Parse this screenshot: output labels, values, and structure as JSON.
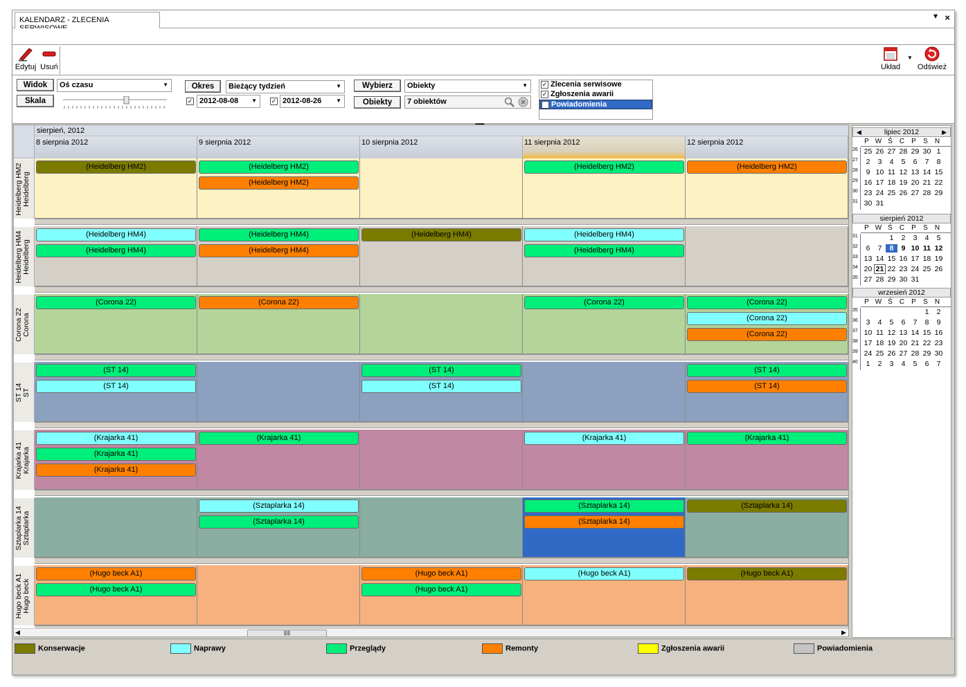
{
  "window": {
    "tab_title": "KALENDARZ - ZLECENIA SERWISOWE",
    "min_glyph": "▾",
    "close_glyph": "×"
  },
  "toolbar": {
    "edit": "Edytuj",
    "delete": "Usuń",
    "layout": "Układ",
    "refresh": "Odśwież"
  },
  "filters": {
    "view_label": "Widok",
    "view_value": "Oś czasu",
    "scale_label": "Skala",
    "period_label": "Okres",
    "period_value": "Bieżący tydzień",
    "date_from": "2012-08-08",
    "date_to": "2012-08-26",
    "select_label": "Wybierz",
    "select_value": "Obiekty",
    "objects_label": "Obiekty",
    "objects_value": "7 obiektów",
    "event_types": [
      {
        "label": "Zlecenia serwisowe",
        "checked": true,
        "selected": false
      },
      {
        "label": "Zgłoszenia awarii",
        "checked": true,
        "selected": false
      },
      {
        "label": "Powiadomienia",
        "checked": true,
        "selected": true
      }
    ]
  },
  "schedule": {
    "month_header": "sierpień, 2012",
    "days": [
      "8 sierpnia 2012",
      "9 sierpnia 2012",
      "10 sierpnia 2012",
      "11 sierpnia 2012",
      "12 sierpnia 2012"
    ],
    "today_index": 3,
    "resources": [
      {
        "line1": "Heidelberg HM2",
        "line2": "Heidelberg",
        "bg": "#fdf2c4",
        "events": [
          [
            [
              "Konserwacje",
              "(Heidelberg HM2)"
            ]
          ],
          [
            [
              "Przeglądy",
              "(Heidelberg HM2)"
            ],
            [
              "Remonty",
              "(Heidelberg HM2)"
            ]
          ],
          [],
          [
            [
              "Przeglądy",
              "(Heidelberg HM2)"
            ]
          ],
          [
            [
              "Remonty",
              "(Heidelberg HM2)"
            ]
          ]
        ]
      },
      {
        "line1": "Heidelberg HM4",
        "line2": "Heidelberg",
        "bg": "#d5d0c7",
        "events": [
          [
            [
              "Naprawy",
              "(Heidelberg HM4)"
            ],
            [
              "Przeglądy",
              "(Heidelberg HM4)"
            ]
          ],
          [
            [
              "Przeglądy",
              "(Heidelberg HM4)"
            ],
            [
              "Remonty",
              "(Heidelberg HM4)"
            ]
          ],
          [
            [
              "Konserwacje",
              "(Heidelberg HM4)"
            ]
          ],
          [
            [
              "Naprawy",
              "(Heidelberg HM4)"
            ],
            [
              "Przeglądy",
              "(Heidelberg HM4)"
            ]
          ],
          []
        ]
      },
      {
        "line1": "Corona 22",
        "line2": "Corona",
        "bg": "#b4d49a",
        "events": [
          [
            [
              "Przeglądy",
              "(Corona 22)"
            ]
          ],
          [
            [
              "Remonty",
              "(Corona 22)"
            ]
          ],
          [],
          [
            [
              "Przeglądy",
              "(Corona 22)"
            ]
          ],
          [
            [
              "Przeglądy",
              "(Corona 22)"
            ],
            [
              "Naprawy",
              "(Corona 22)"
            ],
            [
              "Remonty",
              "(Corona 22)"
            ]
          ]
        ]
      },
      {
        "line1": "ST 14",
        "line2": "ST",
        "bg": "#8ca0bf",
        "events": [
          [
            [
              "Przeglądy",
              "(ST 14)"
            ],
            [
              "Naprawy",
              "(ST 14)"
            ]
          ],
          [],
          [
            [
              "Przeglądy",
              "(ST 14)"
            ],
            [
              "Naprawy",
              "(ST 14)"
            ]
          ],
          [],
          [
            [
              "Przeglądy",
              "(ST 14)"
            ],
            [
              "Remonty",
              "(ST 14)"
            ]
          ]
        ]
      },
      {
        "line1": "Krajarka 41",
        "line2": "Krajarka",
        "bg": "#c088a2",
        "events": [
          [
            [
              "Naprawy",
              "(Krajarka 41)"
            ],
            [
              "Przeglądy",
              "(Krajarka 41)"
            ],
            [
              "Remonty",
              "(Krajarka 41)"
            ]
          ],
          [
            [
              "Przeglądy",
              "(Krajarka 41)"
            ]
          ],
          [],
          [
            [
              "Naprawy",
              "(Krajarka 41)"
            ]
          ],
          [
            [
              "Przeglądy",
              "(Krajarka 41)"
            ]
          ]
        ]
      },
      {
        "line1": "Sztaplarka 14",
        "line2": "Sztaplarka",
        "bg": "#8aaea2",
        "events": [
          [],
          [
            [
              "Naprawy",
              "(Sztaplarka 14)"
            ],
            [
              "Przeglądy",
              "(Sztaplarka 14)"
            ]
          ],
          [],
          [
            [
              "Przeglądy",
              "(Sztaplarka 14)"
            ],
            [
              "Remonty",
              "(Sztaplarka 14)"
            ]
          ],
          [
            [
              "Konserwacje",
              "(Sztaplarka 14)"
            ]
          ]
        ]
      },
      {
        "line1": "Hugo beck A1",
        "line2": "Hugo beck",
        "bg": "#f6b17f",
        "events": [
          [
            [
              "Remonty",
              "(Hugo beck A1)"
            ],
            [
              "Przeglądy",
              "(Hugo beck A1)"
            ]
          ],
          [],
          [
            [
              "Remonty",
              "(Hugo beck A1)"
            ],
            [
              "Przeglądy",
              "(Hugo beck A1)"
            ]
          ],
          [
            [
              "Naprawy",
              "(Hugo beck A1)"
            ]
          ],
          [
            [
              "Konserwacje",
              "(Hugo beck A1)"
            ]
          ]
        ]
      }
    ],
    "selected_cell": {
      "resource": 5,
      "day": 3,
      "color": "#316ac5"
    }
  },
  "legend": [
    {
      "label": "Konserwacje",
      "color": "#7b7b00"
    },
    {
      "label": "Naprawy",
      "color": "#80ffff"
    },
    {
      "label": "Przeglądy",
      "color": "#00ee7a"
    },
    {
      "label": "Remonty",
      "color": "#ff8000"
    },
    {
      "label": "Zgłoszenia awarii",
      "color": "#ffff00"
    },
    {
      "label": "Powiadomienia",
      "color": "#c4c4c4"
    }
  ],
  "calendar": {
    "dow": [
      "P",
      "W",
      "Ś",
      "C",
      "P",
      "S",
      "N"
    ],
    "months": [
      {
        "title": "lipiec 2012",
        "nav": true,
        "weeks": [
          {
            "wn": "26",
            "days": [
              "25",
              "26",
              "27",
              "28",
              "29",
              "30",
              "1"
            ]
          },
          {
            "wn": "27",
            "days": [
              "2",
              "3",
              "4",
              "5",
              "6",
              "7",
              "8"
            ]
          },
          {
            "wn": "28",
            "days": [
              "9",
              "10",
              "11",
              "12",
              "13",
              "14",
              "15"
            ]
          },
          {
            "wn": "29",
            "days": [
              "16",
              "17",
              "18",
              "19",
              "20",
              "21",
              "22"
            ]
          },
          {
            "wn": "30",
            "days": [
              "23",
              "24",
              "25",
              "26",
              "27",
              "28",
              "29"
            ]
          },
          {
            "wn": "31",
            "days": [
              "30",
              "31",
              "",
              "",
              "",
              "",
              ""
            ]
          }
        ]
      },
      {
        "title": "sierpień 2012",
        "nav": false,
        "weeks": [
          {
            "wn": "31",
            "days": [
              "",
              "",
              "1",
              "2",
              "3",
              "4",
              "5"
            ]
          },
          {
            "wn": "32",
            "days": [
              "6",
              "7",
              "8",
              "9",
              "10",
              "11",
              "12"
            ]
          },
          {
            "wn": "33",
            "days": [
              "13",
              "14",
              "15",
              "16",
              "17",
              "18",
              "19"
            ]
          },
          {
            "wn": "34",
            "days": [
              "20",
              "21",
              "22",
              "23",
              "24",
              "25",
              "26"
            ]
          },
          {
            "wn": "35",
            "days": [
              "27",
              "28",
              "29",
              "30",
              "31",
              "",
              ""
            ]
          }
        ]
      },
      {
        "title": "wrzesień 2012",
        "nav": false,
        "weeks": [
          {
            "wn": "35",
            "days": [
              "",
              "",
              "",
              "",
              "",
              "1",
              "2"
            ]
          },
          {
            "wn": "36",
            "days": [
              "3",
              "4",
              "5",
              "6",
              "7",
              "8",
              "9"
            ]
          },
          {
            "wn": "37",
            "days": [
              "10",
              "11",
              "12",
              "13",
              "14",
              "15",
              "16"
            ]
          },
          {
            "wn": "38",
            "days": [
              "17",
              "18",
              "19",
              "20",
              "21",
              "22",
              "23"
            ]
          },
          {
            "wn": "39",
            "days": [
              "24",
              "25",
              "26",
              "27",
              "28",
              "29",
              "30"
            ]
          },
          {
            "wn": "40",
            "days": [
              "1",
              "2",
              "3",
              "4",
              "5",
              "6",
              "7"
            ]
          }
        ]
      }
    ],
    "selected_day": "8",
    "bold_days": [
      "9",
      "10",
      "11",
      "12"
    ],
    "boxed_day": "21"
  }
}
